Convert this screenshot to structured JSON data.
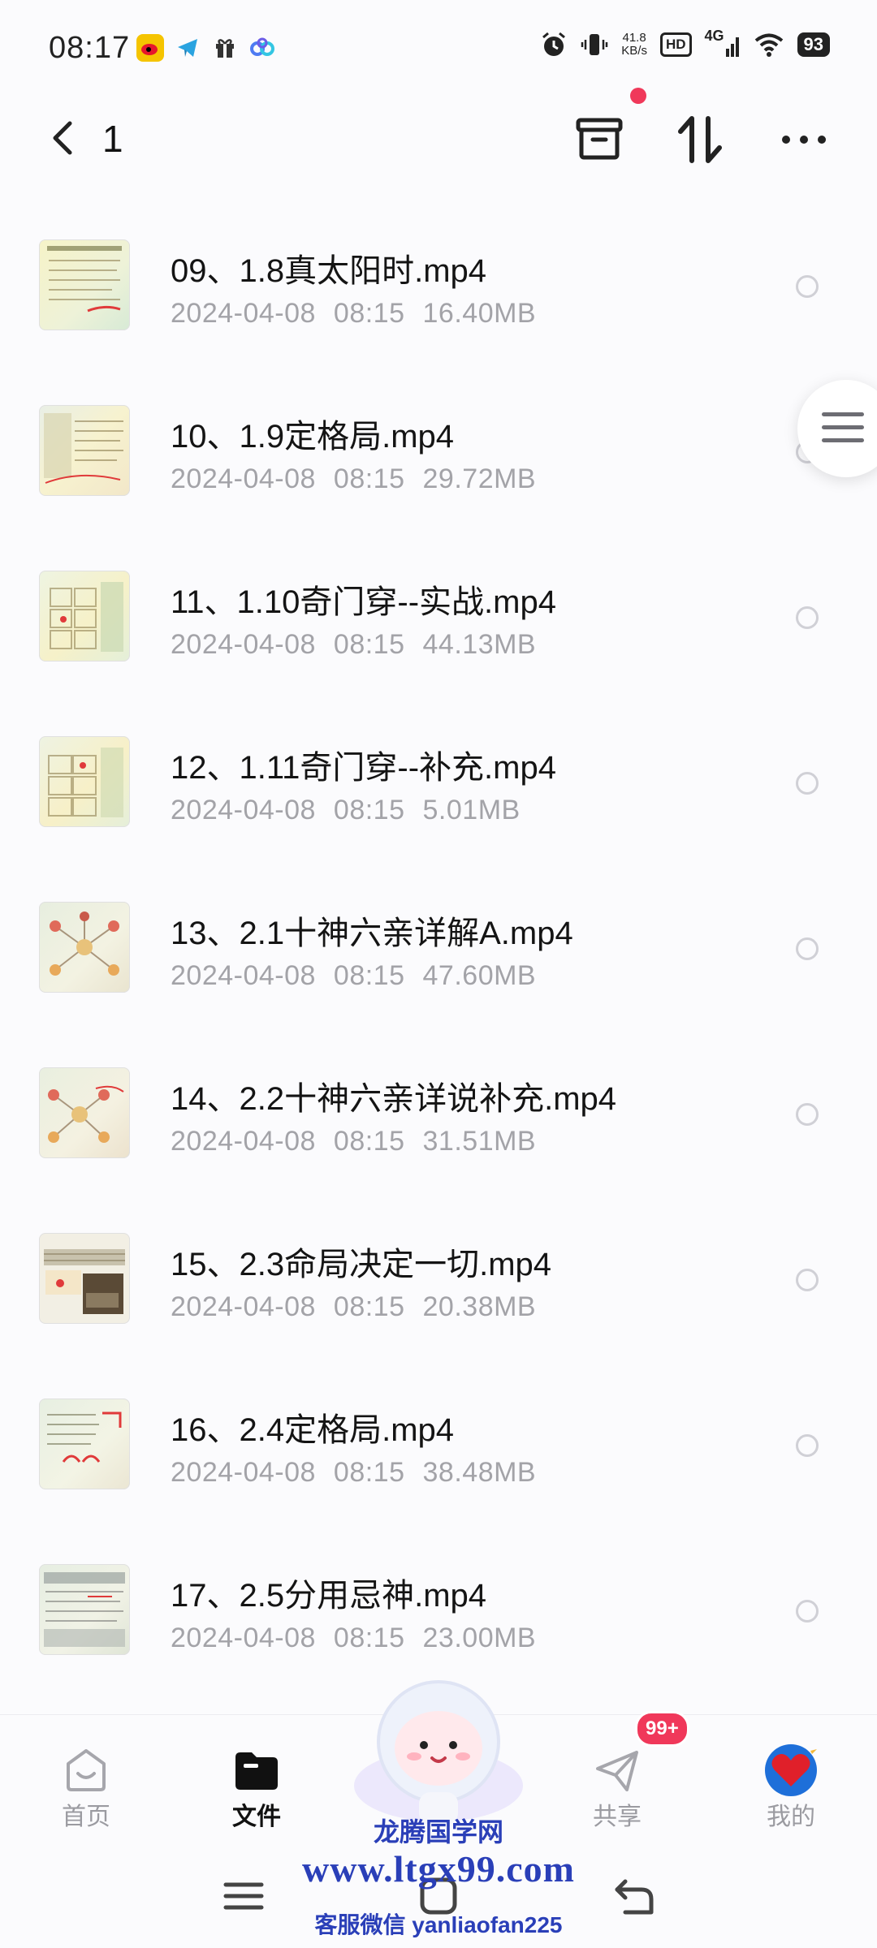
{
  "status_bar": {
    "time": "08:17",
    "net_speed_value": "41.8",
    "net_speed_unit": "KB/s",
    "hd": "HD",
    "signal": "4G",
    "battery": "93"
  },
  "header": {
    "title": "1"
  },
  "files": [
    {
      "name": "09、1.8真太阳时.mp4",
      "date": "2024-04-08",
      "time": "08:15",
      "size": "16.40MB"
    },
    {
      "name": "10、1.9定格局.mp4",
      "date": "2024-04-08",
      "time": "08:15",
      "size": "29.72MB"
    },
    {
      "name": "11、1.10奇门穿--实战.mp4",
      "date": "2024-04-08",
      "time": "08:15",
      "size": "44.13MB"
    },
    {
      "name": "12、1.11奇门穿--补充.mp4",
      "date": "2024-04-08",
      "time": "08:15",
      "size": "5.01MB"
    },
    {
      "name": "13、2.1十神六亲详解A.mp4",
      "date": "2024-04-08",
      "time": "08:15",
      "size": "47.60MB"
    },
    {
      "name": "14、2.2十神六亲详说补充.mp4",
      "date": "2024-04-08",
      "time": "08:15",
      "size": "31.51MB"
    },
    {
      "name": "15、2.3命局决定一切.mp4",
      "date": "2024-04-08",
      "time": "08:15",
      "size": "20.38MB"
    },
    {
      "name": "16、2.4定格局.mp4",
      "date": "2024-04-08",
      "time": "08:15",
      "size": "38.48MB"
    },
    {
      "name": "17、2.5分用忌神.mp4",
      "date": "2024-04-08",
      "time": "08:15",
      "size": "23.00MB"
    }
  ],
  "bottom_nav": {
    "home": "首页",
    "files": "文件",
    "share": "共享",
    "me": "我的",
    "share_badge": "99+"
  },
  "watermark": {
    "title": "龙腾国学网",
    "url": "www.ltgx99.com",
    "contact": "客服微信 yanliaofan225"
  },
  "colors": {
    "accent_red": "#f0385a",
    "watermark_blue": "#2a3fb8",
    "meta_gray": "#a3a3a8"
  }
}
